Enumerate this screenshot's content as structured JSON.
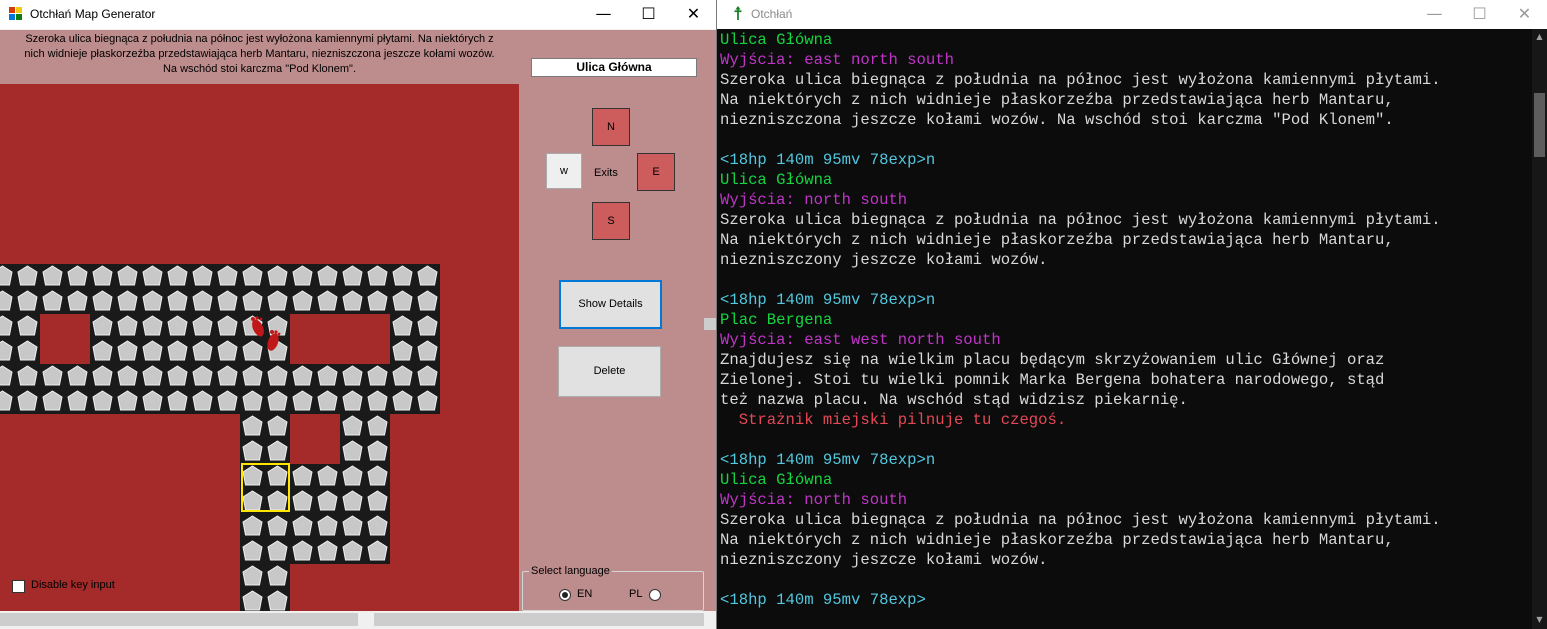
{
  "map_window": {
    "title": "Otchłań Map Generator",
    "buttons": {
      "minimize": "—",
      "maximize": "☐",
      "close": "✕"
    },
    "description": "Szeroka ulica biegnąca z południa na północ jest wyłożona kamiennymi płytami. Na niektórych z nich widnieje płaskorzeźba przedstawiająca herb Mantaru, niezniszczona jeszcze kołami wozów. Na wschód stoi karczma \"Pod Klonem\".",
    "room_name": "Ulica Główna",
    "exits": {
      "north": "N",
      "west": "w",
      "east": "E",
      "south": "S",
      "label": "Exits"
    },
    "show_details_label": "Show Details",
    "delete_label": "Delete",
    "disable_key_input_label": "Disable key input",
    "disable_key_input_checked": false,
    "language": {
      "legend": "Select language",
      "en": "EN",
      "pl": "PL",
      "selected": "EN"
    },
    "colors": {
      "map_bg": "#a52a2a",
      "panel_bg": "#bd8c8c",
      "exit_on": "#cd5c5c",
      "selector": "#ffe600"
    }
  },
  "terminal_window": {
    "title": "Otchłań",
    "buttons": {
      "minimize": "—",
      "maximize": "☐",
      "close": "✕"
    },
    "lines": [
      {
        "text": "Ulica Główna",
        "color": "green"
      },
      {
        "text": "Wyjścia: east north south",
        "color": "magenta"
      },
      {
        "text": "Szeroka ulica biegnąca z południa na północ jest wyłożona kamiennymi płytami.",
        "color": "white"
      },
      {
        "text": "Na niektórych z nich widnieje płaskorzeźba przedstawiająca herb Mantaru,",
        "color": "white"
      },
      {
        "text": "niezniszczona jeszcze kołami wozów. Na wschód stoi karczma \"Pod Klonem\".",
        "color": "white"
      },
      {
        "text": "",
        "color": "white"
      },
      {
        "text": "<18hp 140m 95mv 78exp>n",
        "color": "cyan"
      },
      {
        "text": "Ulica Główna",
        "color": "green"
      },
      {
        "text": "Wyjścia: north south",
        "color": "magenta"
      },
      {
        "text": "Szeroka ulica biegnąca z południa na północ jest wyłożona kamiennymi płytami.",
        "color": "white"
      },
      {
        "text": "Na niektórych z nich widnieje płaskorzeźba przedstawiająca herb Mantaru,",
        "color": "white"
      },
      {
        "text": "niezniszczony jeszcze kołami wozów.",
        "color": "white"
      },
      {
        "text": "",
        "color": "white"
      },
      {
        "text": "<18hp 140m 95mv 78exp>n",
        "color": "cyan"
      },
      {
        "text": "Plac Bergena",
        "color": "green"
      },
      {
        "text": "Wyjścia: east west north south",
        "color": "magenta"
      },
      {
        "text": "Znajdujesz się na wielkim placu będącym skrzyżowaniem ulic Głównej oraz",
        "color": "white"
      },
      {
        "text": "Zielonej. Stoi tu wielki pomnik Marka Bergena bohatera narodowego, stąd",
        "color": "white"
      },
      {
        "text": "też nazwa placu. Na wschód stąd widzisz piekarnię.",
        "color": "white"
      },
      {
        "text": "  Strażnik miejski pilnuje tu czegoś.",
        "color": "red"
      },
      {
        "text": "",
        "color": "white"
      },
      {
        "text": "<18hp 140m 95mv 78exp>n",
        "color": "cyan"
      },
      {
        "text": "Ulica Główna",
        "color": "green"
      },
      {
        "text": "Wyjścia: north south",
        "color": "magenta"
      },
      {
        "text": "Szeroka ulica biegnąca z południa na północ jest wyłożona kamiennymi płytami.",
        "color": "white"
      },
      {
        "text": "Na niektórych z nich widnieje płaskorzeźba przedstawiająca herb Mantaru,",
        "color": "white"
      },
      {
        "text": "niezniszczony jeszcze kołami wozów.",
        "color": "white"
      },
      {
        "text": "",
        "color": "white"
      },
      {
        "text": "<18hp 140m 95mv 78exp>",
        "color": "cyan"
      }
    ]
  }
}
